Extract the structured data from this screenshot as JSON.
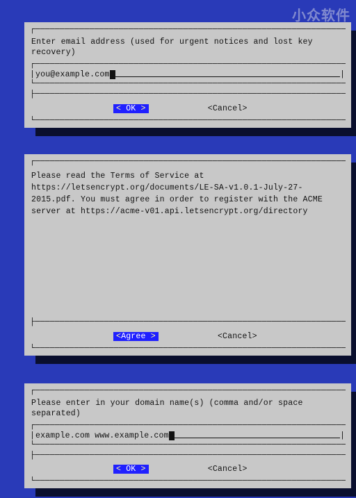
{
  "watermark": "小众软件",
  "dialog1": {
    "prompt": "Enter email address (used for urgent notices and lost key recovery)",
    "input_value": "you@example.com",
    "ok_label": "< OK >",
    "cancel_label": "<Cancel>"
  },
  "dialog2": {
    "text": "Please read the Terms of Service at https://letsencrypt.org/documents/LE-SA-v1.0.1-July-27-2015.pdf. You must agree in order to register with the ACME server at https://acme-v01.api.letsencrypt.org/directory",
    "agree_label": "<Agree >",
    "cancel_label": "<Cancel>"
  },
  "dialog3": {
    "prompt": "Please enter in your domain name(s) (comma and/or space separated)",
    "input_value": "example.com www.example.com",
    "ok_label": "< OK >",
    "cancel_label": "<Cancel>"
  },
  "colors": {
    "background": "#293ab8",
    "panel": "#c8c8c8",
    "shadow": "#0a0f2e",
    "highlight_bg": "#2020ff",
    "highlight_fg": "#ffffff"
  }
}
